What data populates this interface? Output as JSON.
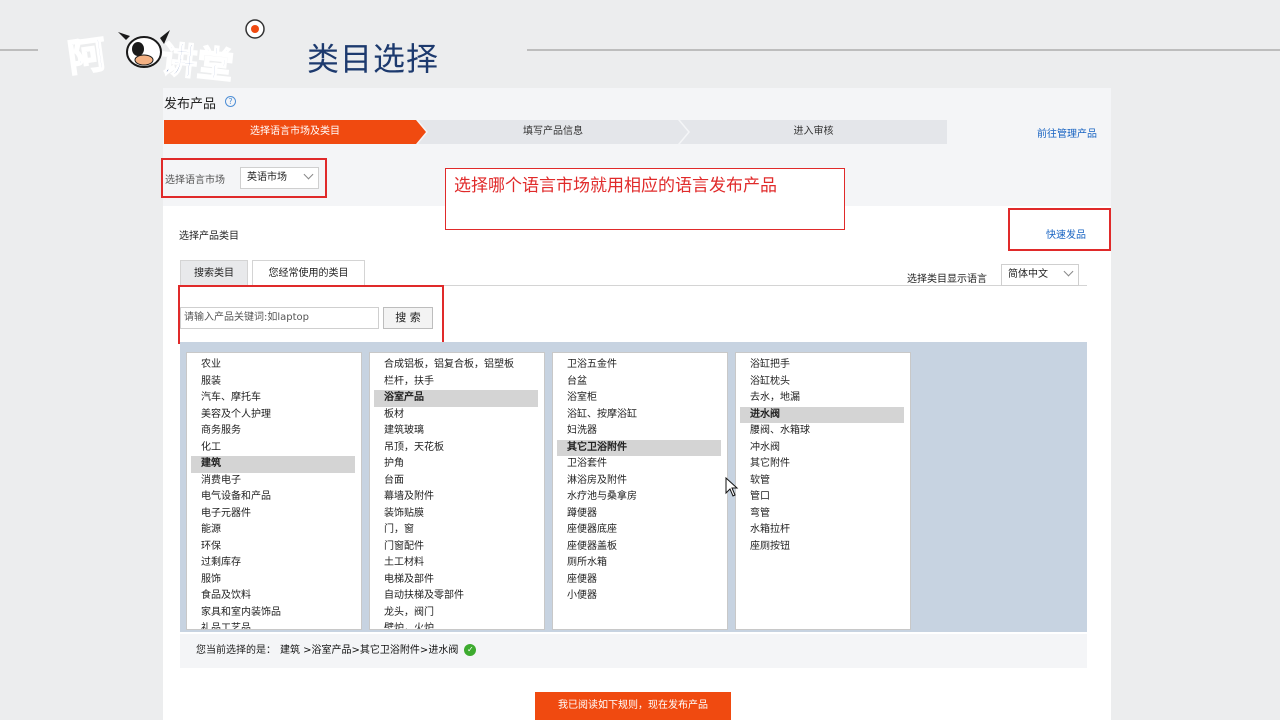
{
  "slide": {
    "title": "类目选择",
    "logo_text": "阿 讲堂"
  },
  "page": {
    "title": "发布产品",
    "help_icon": "?",
    "steps": [
      "选择语言市场及类目",
      "填写产品信息",
      "进入审核"
    ],
    "manage_link": "前往管理产品",
    "language_market_label": "选择语言市场",
    "language_market_value": "英语市场",
    "annotation": "选择哪个语言市场就用相应的语言发布产品",
    "category_title": "选择产品类目",
    "quick_publish": "快速发品",
    "tabs": [
      "搜索类目",
      "您经常使用的类目"
    ],
    "display_language_label": "选择类目显示语言",
    "display_language_value": "简体中文",
    "search_placeholder": "请输入产品关键词:如laptop",
    "search_button": "搜 索",
    "current_selection_label": "您当前选择的是：",
    "current_selection_path": "建筑 >浴室产品>其它卫浴附件>进水阀",
    "submit_button": "我已阅读如下规则，现在发布产品"
  },
  "columns": [
    {
      "items": [
        "农业",
        "服装",
        "汽车、摩托车",
        "美容及个人护理",
        "商务服务",
        "化工",
        "建筑",
        "消费电子",
        "电气设备和产品",
        "电子元器件",
        "能源",
        "环保",
        "过剩库存",
        "服饰",
        "食品及饮料",
        "家具和室内装饰品",
        "礼品工艺品"
      ],
      "selected": 6
    },
    {
      "items": [
        "合成铝板，铝复合板，铝塑板",
        "栏杆，扶手",
        "浴室产品",
        "板材",
        "建筑玻璃",
        "吊顶，天花板",
        "护角",
        "台面",
        "幕墙及附件",
        "装饰贴膜",
        "门，窗",
        "门窗配件",
        "土工材料",
        "电梯及部件",
        "自动扶梯及零部件",
        "龙头，阀门",
        "壁炉，火炉"
      ],
      "selected": 2
    },
    {
      "items": [
        "卫浴五金件",
        "台盆",
        "浴室柜",
        "浴缸、按摩浴缸",
        "妇洗器",
        "其它卫浴附件",
        "卫浴套件",
        "淋浴房及附件",
        "水疗池与桑拿房",
        "蹲便器",
        "座便器底座",
        "座便器盖板",
        "厕所水箱",
        "座便器",
        "小便器"
      ],
      "selected": 5
    },
    {
      "items": [
        "浴缸把手",
        "浴缸枕头",
        "去水，地漏",
        "进水阀",
        "腰阀、水箱球",
        "冲水阀",
        "其它附件",
        "软管",
        "管口",
        "弯管",
        "水箱拉杆",
        "座厕按钮"
      ],
      "selected": 3
    }
  ],
  "colors": {
    "accent": "#f04a10",
    "annotation": "#e02a2a",
    "link": "#1763c2",
    "title": "#1d3a6e"
  }
}
